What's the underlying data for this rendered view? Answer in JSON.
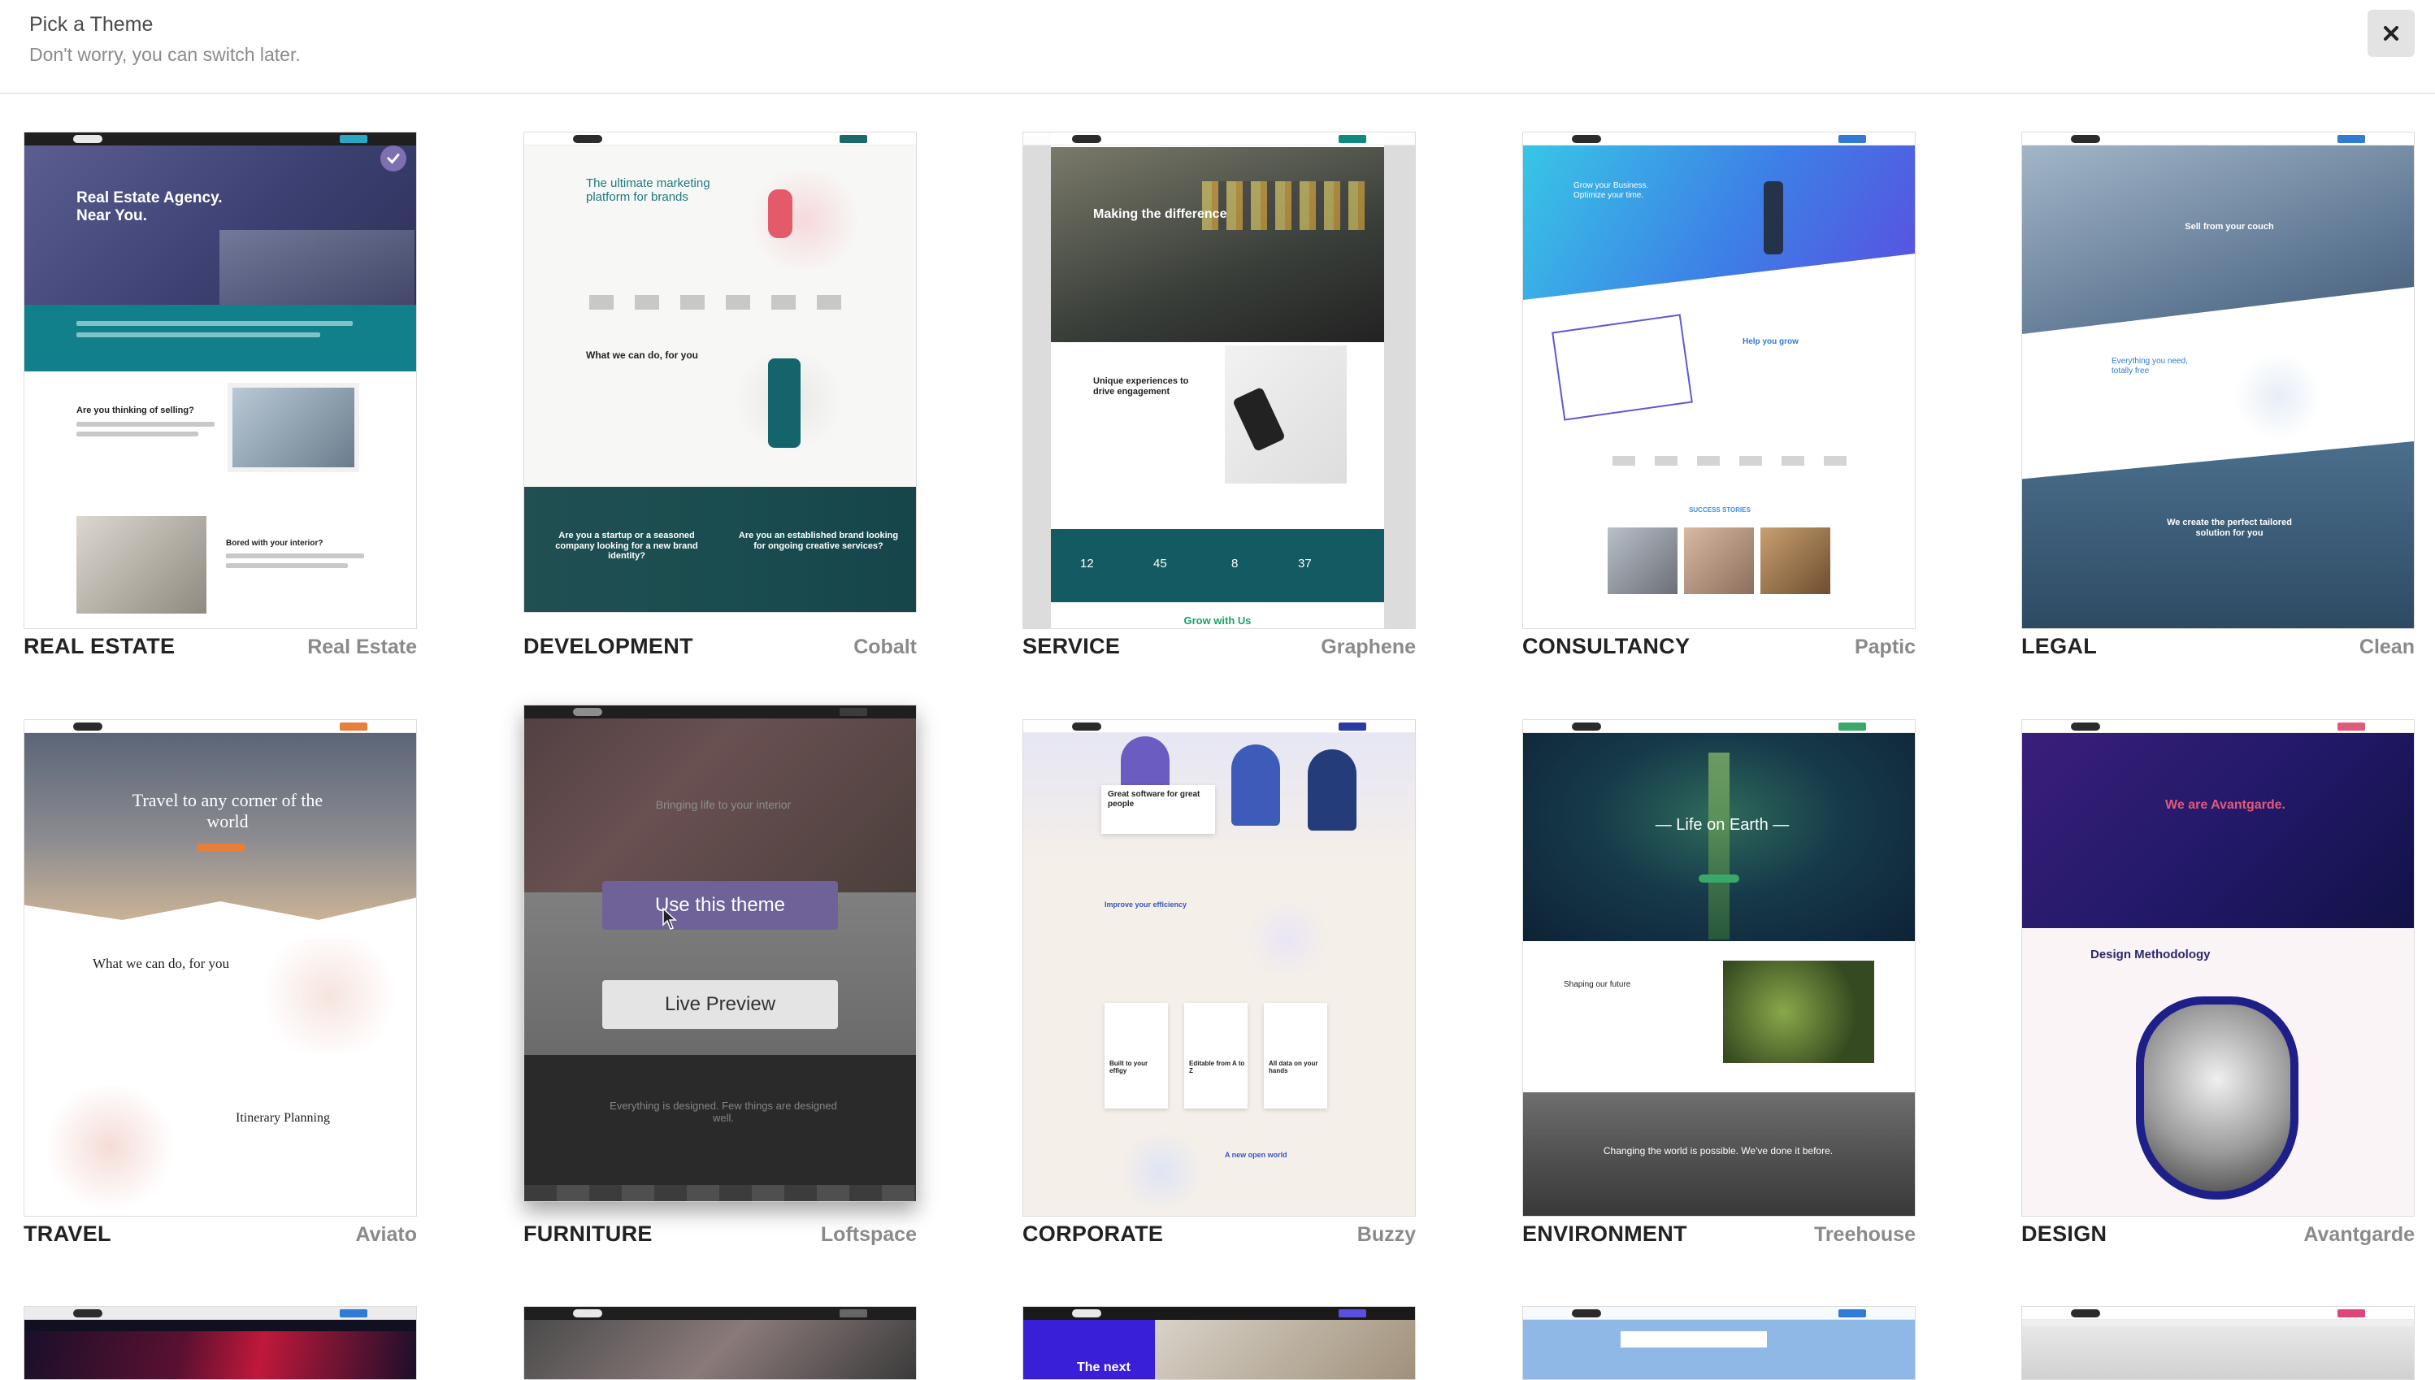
{
  "header": {
    "title": "Pick a Theme",
    "subtitle": "Don't worry, you can switch later.",
    "close_icon": "close-icon"
  },
  "themes": [
    {
      "category": "REAL ESTATE",
      "name": "Real Estate",
      "selected": true,
      "preview": {
        "headline": "Real Estate Agency.\nNear You.",
        "section1": "Are you thinking of selling?",
        "section2": "Bored with your interior?"
      }
    },
    {
      "category": "DEVELOPMENT",
      "name": "Cobalt",
      "preview": {
        "headline": "The ultimate marketing platform for brands",
        "section1": "What we can do, for you",
        "section2": "Are you a startup or a seasoned company looking for a new brand identity?",
        "section3": "Are you an established brand looking for ongoing creative services?"
      }
    },
    {
      "category": "SERVICE",
      "name": "Graphene",
      "preview": {
        "headline": "Making the difference",
        "section1": "Unique experiences to drive engagement",
        "stats": [
          "12",
          "45",
          "8",
          "37"
        ],
        "footer": "Grow with Us"
      }
    },
    {
      "category": "CONSULTANCY",
      "name": "Paptic",
      "preview": {
        "headline": "Grow your Business. Optimize your time.",
        "section1": "Help you grow",
        "section2": "SUCCESS STORIES"
      }
    },
    {
      "category": "LEGAL",
      "name": "Clean",
      "preview": {
        "headline": "Sell from your couch",
        "section1": "Everything you need, totally free",
        "section2": "We create the perfect tailored solution for you"
      }
    },
    {
      "category": "TRAVEL",
      "name": "Aviato",
      "preview": {
        "headline": "Travel to any corner of the world",
        "section1": "What we can do, for you",
        "section2": "Itinerary Planning"
      }
    },
    {
      "category": "FURNITURE",
      "name": "Loftspace",
      "hovered": true,
      "preview": {
        "headline": "Bringing life to your interior",
        "section1": "Everything is designed. Few things are designed well."
      },
      "actions": {
        "use": "Use this theme",
        "preview": "Live Preview"
      }
    },
    {
      "category": "CORPORATE",
      "name": "Buzzy",
      "preview": {
        "headline": "Great software for great people",
        "section1": "Improve your efficiency",
        "cols": [
          "Built to your effigy",
          "Editable from A to Z",
          "All data on your hands"
        ],
        "section2": "A new open world"
      }
    },
    {
      "category": "ENVIRONMENT",
      "name": "Treehouse",
      "preview": {
        "headline": "— Life on Earth —",
        "section1": "Shaping our future",
        "section2": "Changing the world is possible. We've done it before."
      }
    },
    {
      "category": "DESIGN",
      "name": "Avantgarde",
      "preview": {
        "headline": "We are Avantgarde.",
        "section1": "Design Methodology"
      }
    }
  ],
  "third_row": {
    "corporate_text": "The next"
  },
  "colors": {
    "accent": "#6e6299",
    "check": "#7d6fb1",
    "teal": "#11808a"
  }
}
